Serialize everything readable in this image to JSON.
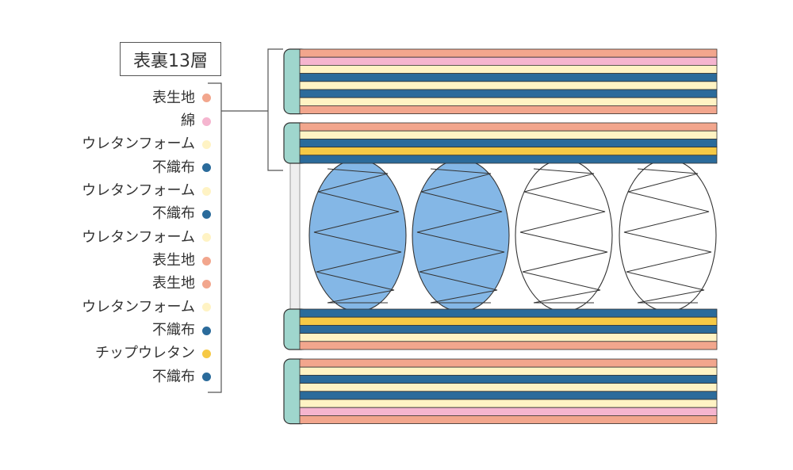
{
  "title": "表裏13層",
  "legend": [
    {
      "label": "表生地",
      "color": "#f2a68d"
    },
    {
      "label": "綿",
      "color": "#f5b5cf"
    },
    {
      "label": "ウレタンフォーム",
      "color": "#fff3c4"
    },
    {
      "label": "不織布",
      "color": "#2b6b9b"
    },
    {
      "label": "ウレタンフォーム",
      "color": "#fff3c4"
    },
    {
      "label": "不織布",
      "color": "#2b6b9b"
    },
    {
      "label": "ウレタンフォーム",
      "color": "#fff3c4"
    },
    {
      "label": "表生地",
      "color": "#f2a68d"
    },
    {
      "label": "表生地",
      "color": "#f2a68d"
    },
    {
      "label": "ウレタンフォーム",
      "color": "#fff3c4"
    },
    {
      "label": "不織布",
      "color": "#2b6b9b"
    },
    {
      "label": "チップウレタン",
      "color": "#f6c945"
    },
    {
      "label": "不織布",
      "color": "#2b6b9b"
    }
  ],
  "mattress": {
    "colors": {
      "edge": "#9fd6cd",
      "spring_fill": "#84b7e6",
      "spring_empty": "#ffffff",
      "outline": "#333333",
      "core_side": "#eeeeee",
      "bracket": "#555555"
    },
    "blocks": [
      {
        "layers": [
          "#f2a68d",
          "#f5b5cf",
          "#fff3c4",
          "#2b6b9b",
          "#fff3c4",
          "#2b6b9b",
          "#fff3c4",
          "#f2a68d"
        ]
      },
      {
        "layers": [
          "#f2a68d",
          "#fff3c4",
          "#2b6b9b",
          "#f6c945",
          "#2b6b9b"
        ]
      },
      {
        "layers": [
          "#2b6b9b",
          "#f6c945",
          "#2b6b9b",
          "#fff3c4",
          "#f2a68d"
        ]
      },
      {
        "layers": [
          "#f2a68d",
          "#fff3c4",
          "#2b6b9b",
          "#fff3c4",
          "#2b6b9b",
          "#fff3c4",
          "#f5b5cf",
          "#f2a68d"
        ]
      }
    ],
    "springs": [
      {
        "filled": true
      },
      {
        "filled": true
      },
      {
        "filled": false
      },
      {
        "filled": false
      }
    ]
  }
}
